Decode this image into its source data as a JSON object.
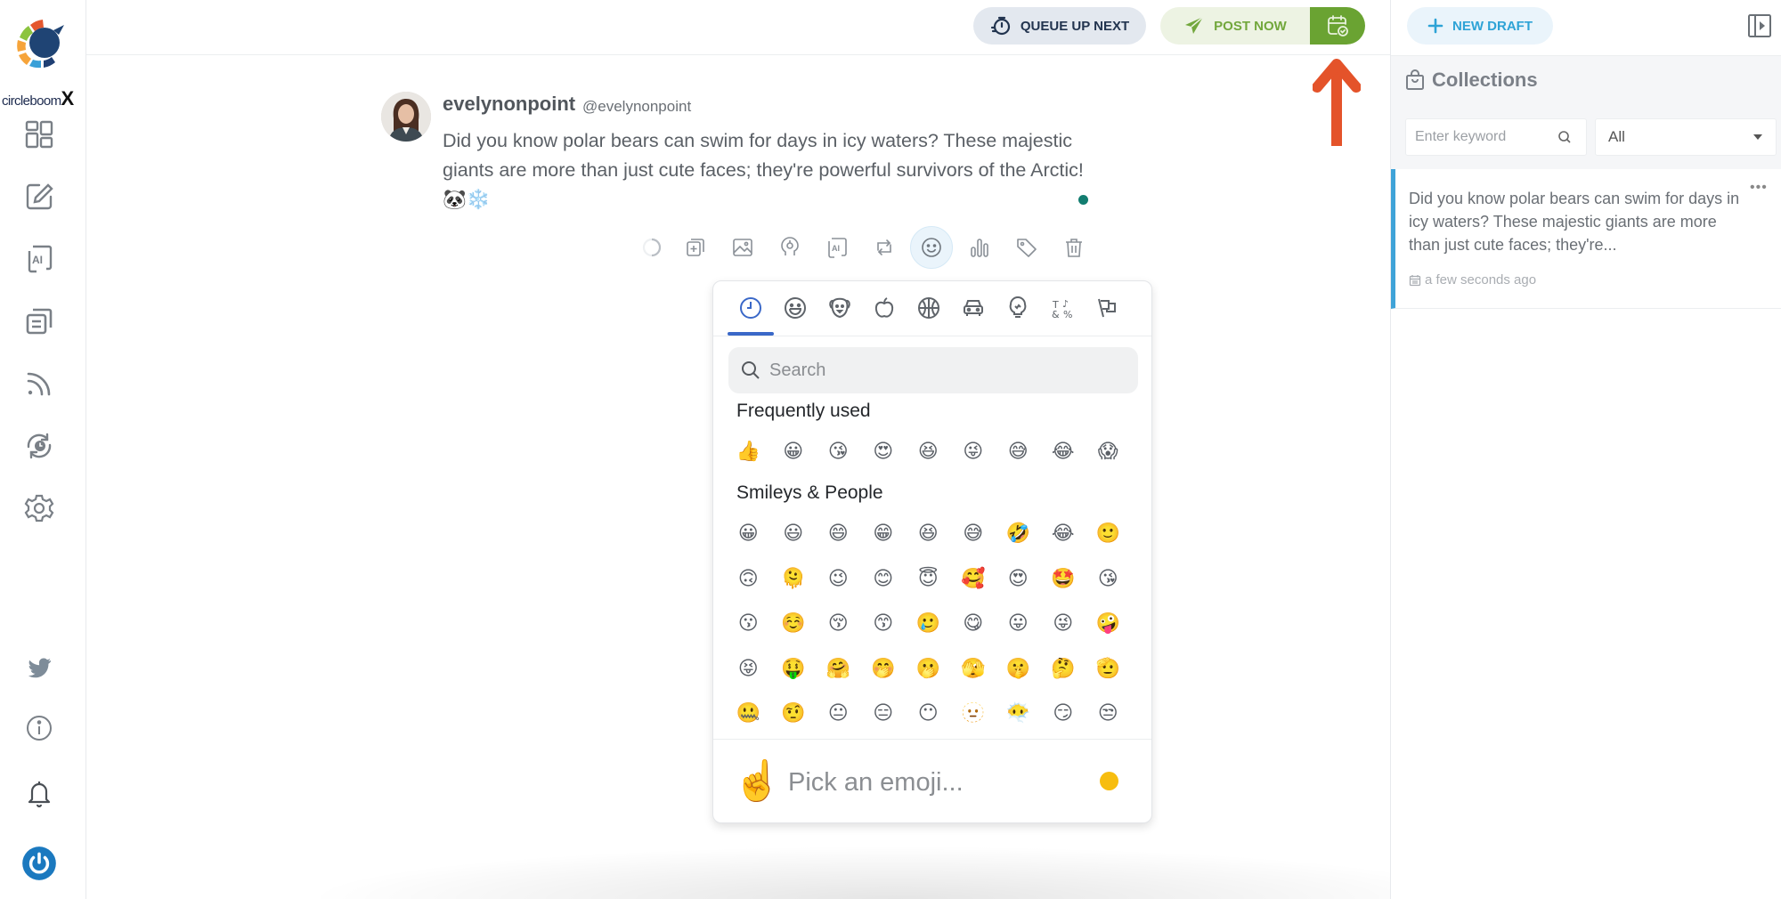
{
  "brand": {
    "name_prefix": "circleboom",
    "name_suffix": "X"
  },
  "sidebar": {
    "items": [
      {
        "name": "dashboard",
        "icon": "dashboard-grid-icon"
      },
      {
        "name": "compose",
        "icon": "edit-icon"
      },
      {
        "name": "ai-writer",
        "icon": "ai-icon"
      },
      {
        "name": "posts",
        "icon": "documents-icon"
      },
      {
        "name": "rss",
        "icon": "rss-icon"
      },
      {
        "name": "schedule",
        "icon": "clock-refresh-icon"
      },
      {
        "name": "settings",
        "icon": "gear-icon"
      }
    ],
    "bottom_items": [
      {
        "name": "twitter",
        "icon": "twitter-icon"
      },
      {
        "name": "info",
        "icon": "info-icon"
      },
      {
        "name": "notifications",
        "icon": "bell-icon"
      },
      {
        "name": "power",
        "icon": "power-icon"
      }
    ]
  },
  "topbar": {
    "queue_label": "QUEUE UP NEXT",
    "post_label": "POST NOW",
    "schedule_icon": "calendar-clock-icon"
  },
  "colors": {
    "post_green": "#6aa332",
    "accent_blue": "#2ea3d6",
    "annotation_arrow": "#e4532a",
    "status_dot": "#127d70"
  },
  "composer": {
    "display_name": "evelynonpoint",
    "handle": "@evelynonpoint",
    "text": "Did you know polar bears can swim for days in icy waters? These majestic giants are more than just cute faces; they're powerful survivors of the Arctic! 🐼❄️",
    "toolbar": [
      "loading-spinner-icon",
      "add-thread-icon",
      "image-icon",
      "gif-icon",
      "ai-icon",
      "retweet-icon",
      "emoji-icon",
      "poll-icon",
      "tag-icon",
      "trash-icon"
    ]
  },
  "emoji_picker": {
    "categories": [
      "recent",
      "smileys",
      "animals",
      "food",
      "activity",
      "travel",
      "objects",
      "symbols",
      "flags"
    ],
    "search_placeholder": "Search",
    "frequently_used_title": "Frequently used",
    "frequently_used": [
      "👍",
      "😀",
      "😘",
      "😍",
      "😆",
      "😜",
      "😅",
      "😂",
      "😱"
    ],
    "smileys_title": "Smileys & People",
    "smileys": [
      "😀",
      "😃",
      "😄",
      "😁",
      "😆",
      "😅",
      "🤣",
      "😂",
      "🙂",
      "🙃",
      "🫠",
      "😉",
      "😊",
      "😇",
      "🥰",
      "😍",
      "🤩",
      "😘",
      "😗",
      "☺️",
      "😚",
      "😙",
      "🥲",
      "😋",
      "😛",
      "😜",
      "🤪",
      "😝",
      "🤑",
      "🤗",
      "🤭",
      "🫢",
      "🫣",
      "🤫",
      "🤔",
      "🫡",
      "🤐",
      "🤨",
      "😐",
      "😑",
      "😶",
      "🫥",
      "😶‍🌫️",
      "😏",
      "😒"
    ],
    "preview_emoji": "☝️",
    "preview_text": "Pick an emoji..."
  },
  "right_panel": {
    "new_draft_label": "NEW DRAFT",
    "collections_title": "Collections",
    "keyword_placeholder": "Enter keyword",
    "filter_value": "All",
    "drafts": [
      {
        "text": "Did you know polar bears can swim for days in icy waters? These majestic giants are more than just cute faces; they're...",
        "time": "a few seconds ago"
      }
    ]
  }
}
